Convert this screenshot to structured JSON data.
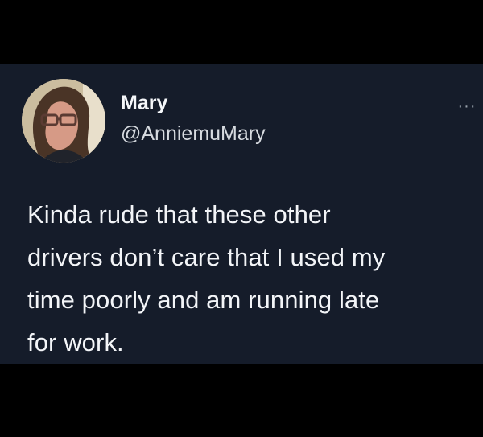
{
  "tweet": {
    "author": {
      "name": "Mary",
      "handle": "@AnniemuMary",
      "avatar_icon": "profile-avatar"
    },
    "more_icon": "···",
    "text_lines": [
      "Kinda rude that these other",
      "drivers don’t care that I used my",
      "time poorly and am running late",
      "for work."
    ]
  },
  "colors": {
    "background": "#000000",
    "card": "#151c2a",
    "text": "#f3f5f8",
    "muted": "#9aa3ad"
  }
}
